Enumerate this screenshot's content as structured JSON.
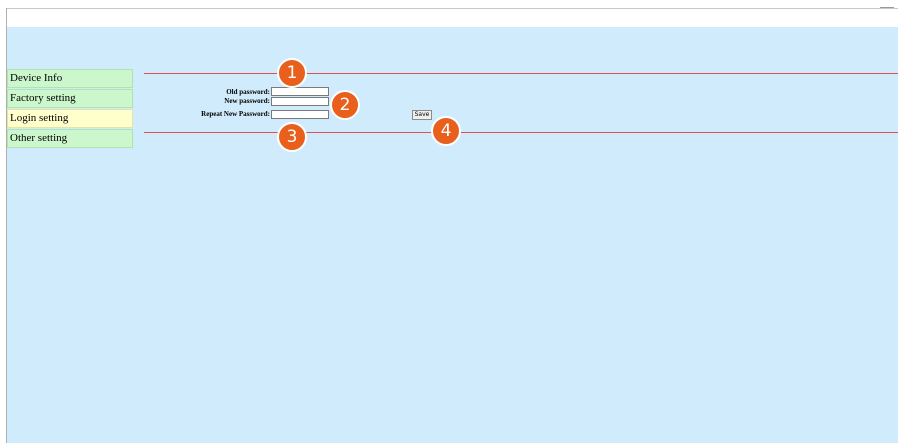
{
  "sidebar": {
    "items": [
      {
        "label": "Device Info"
      },
      {
        "label": "Factory setting"
      },
      {
        "label": "Login setting",
        "active": true
      },
      {
        "label": "Other setting"
      }
    ]
  },
  "form": {
    "old_password_label": "Old password:",
    "new_password_label": "New password:",
    "repeat_password_label": "Repeat New Password:",
    "old_password_value": "",
    "new_password_value": "",
    "repeat_password_value": "",
    "save_label": "Save"
  },
  "callouts": [
    "1",
    "2",
    "3",
    "4"
  ],
  "colors": {
    "content_bg": "#d0ecfc",
    "sidebar_bg": "#ccf7cc",
    "sidebar_active_bg": "#ffffcc",
    "separator_line": "#e05050",
    "callout_bg": "#e8601c"
  }
}
